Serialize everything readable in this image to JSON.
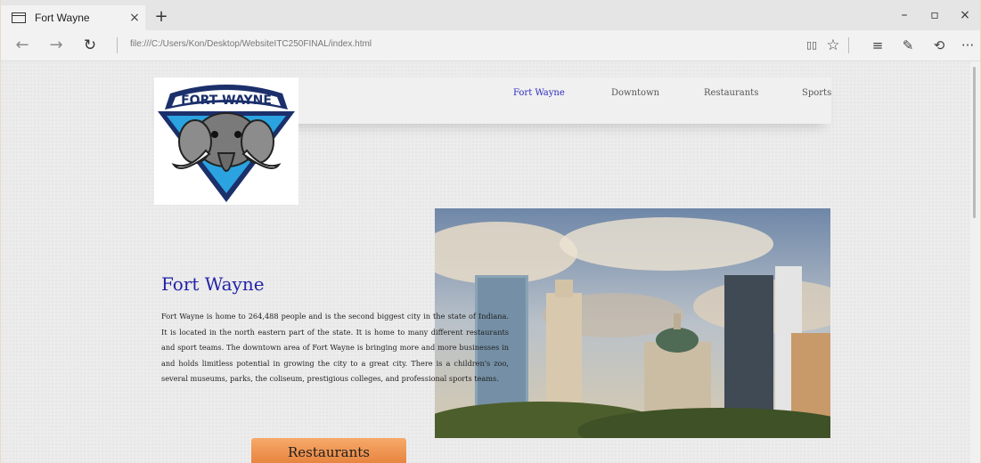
{
  "browser": {
    "tab_title": "Fort Wayne",
    "tab_close": "×",
    "new_tab": "+",
    "url": "file:///C:/Users/Kon/Desktop/WebsiteITC250FINAL/index.html",
    "window_controls": {
      "minimize": "–",
      "restore": "▫",
      "close": "×"
    },
    "nav": {
      "back": "←",
      "forward": "→",
      "refresh": "↻"
    },
    "toolbar": {
      "reading_view": "▯▯",
      "favorite": "☆",
      "hub": "≡",
      "notes": "✎",
      "share": "⟲",
      "more": "···"
    }
  },
  "site": {
    "logo_text": "FORT WAYNE",
    "nav_links": [
      "Fort Wayne",
      "Downtown",
      "Restaurants",
      "Sports"
    ],
    "active_nav": "Fort Wayne",
    "heading": "Fort Wayne",
    "body": "Fort Wayne is home to 264,488 people and is the second biggest city in the state of Indiana. It is located in the north eastern part of the state. It is home to many different restaurants and sport teams. The downtown area of Fort Wayne is bringing more and more businesses in and holds limitless potential in growing the city to a great city. There is a children's zoo, several museums, parks, the coliseum, prestigious colleges, and professional sports teams.",
    "cta_label": "Restaurants"
  },
  "colors": {
    "nav_active": "#2b2bbf",
    "heading": "#2323a8",
    "cta": "#e98a45"
  }
}
